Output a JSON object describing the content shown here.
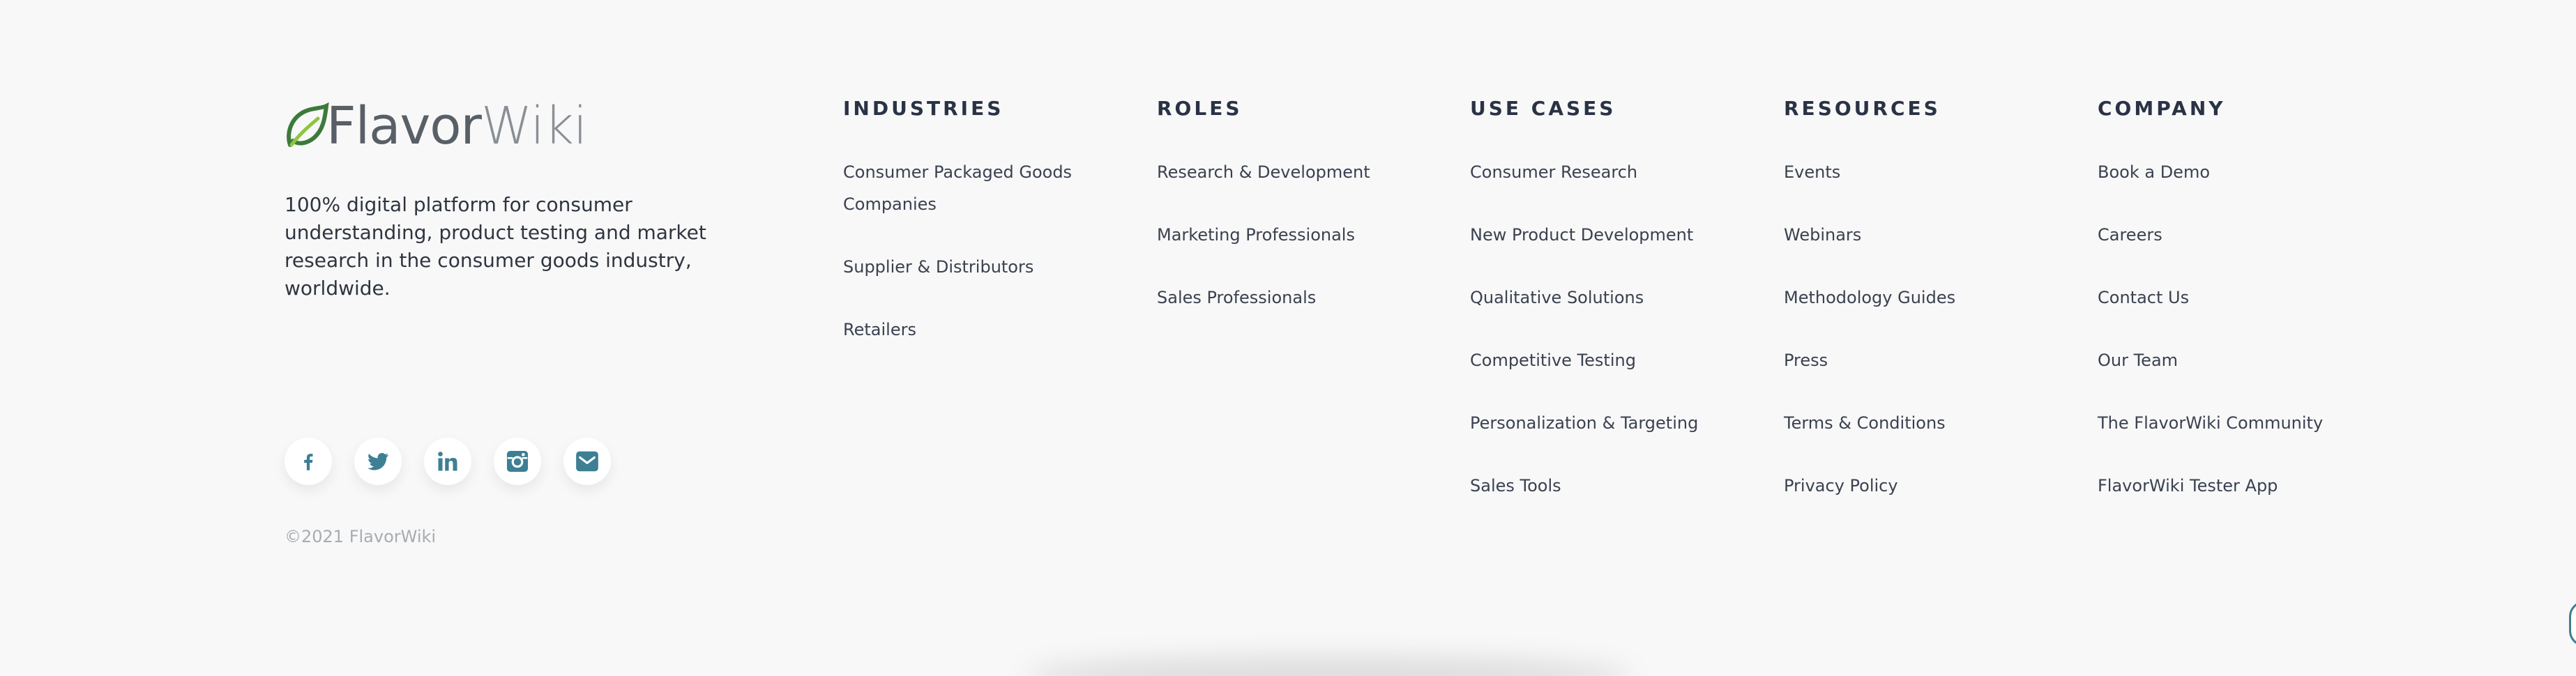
{
  "brand": {
    "logo_flavor": "Flavor",
    "logo_wiki": "Wiki",
    "tagline": "100% digital platform for consumer understanding, product testing and market research in the consumer goods industry, worldwide.",
    "copyright": "©2021 FlavorWiki",
    "socials": [
      {
        "name": "facebook-icon"
      },
      {
        "name": "twitter-icon"
      },
      {
        "name": "linkedin-icon"
      },
      {
        "name": "instagram-icon"
      },
      {
        "name": "email-icon"
      }
    ]
  },
  "colors": {
    "background": "#f8f8f8",
    "icon_accent": "#3d7f93",
    "logo_green_dark": "#3d7a3a",
    "logo_green_light": "#8cc63f",
    "heading": "#2a3245",
    "copyright": "#a7acb3"
  },
  "columns": {
    "industries": {
      "title": "INDUSTRIES",
      "links": [
        "Consumer Packaged Goods Companies",
        "Supplier & Distributors",
        "Retailers"
      ]
    },
    "roles": {
      "title": "ROLES",
      "links": [
        "Research & Development",
        "Marketing Professionals",
        "Sales Professionals"
      ]
    },
    "use_cases": {
      "title": "USE CASES",
      "links": [
        "Consumer Research",
        "New Product Development",
        "Qualitative Solutions",
        "Competitive Testing",
        "Personalization & Targeting",
        "Sales Tools"
      ]
    },
    "resources": {
      "title": "RESOURCES",
      "links": [
        "Events",
        "Webinars",
        "Methodology Guides",
        "Press",
        "Terms & Conditions",
        "Privacy Policy"
      ]
    },
    "company": {
      "title": "COMPANY",
      "links": [
        "Book a Demo",
        "Careers",
        "Contact Us",
        "Our Team",
        "The FlavorWiki Community",
        "FlavorWiki Tester App"
      ]
    }
  }
}
